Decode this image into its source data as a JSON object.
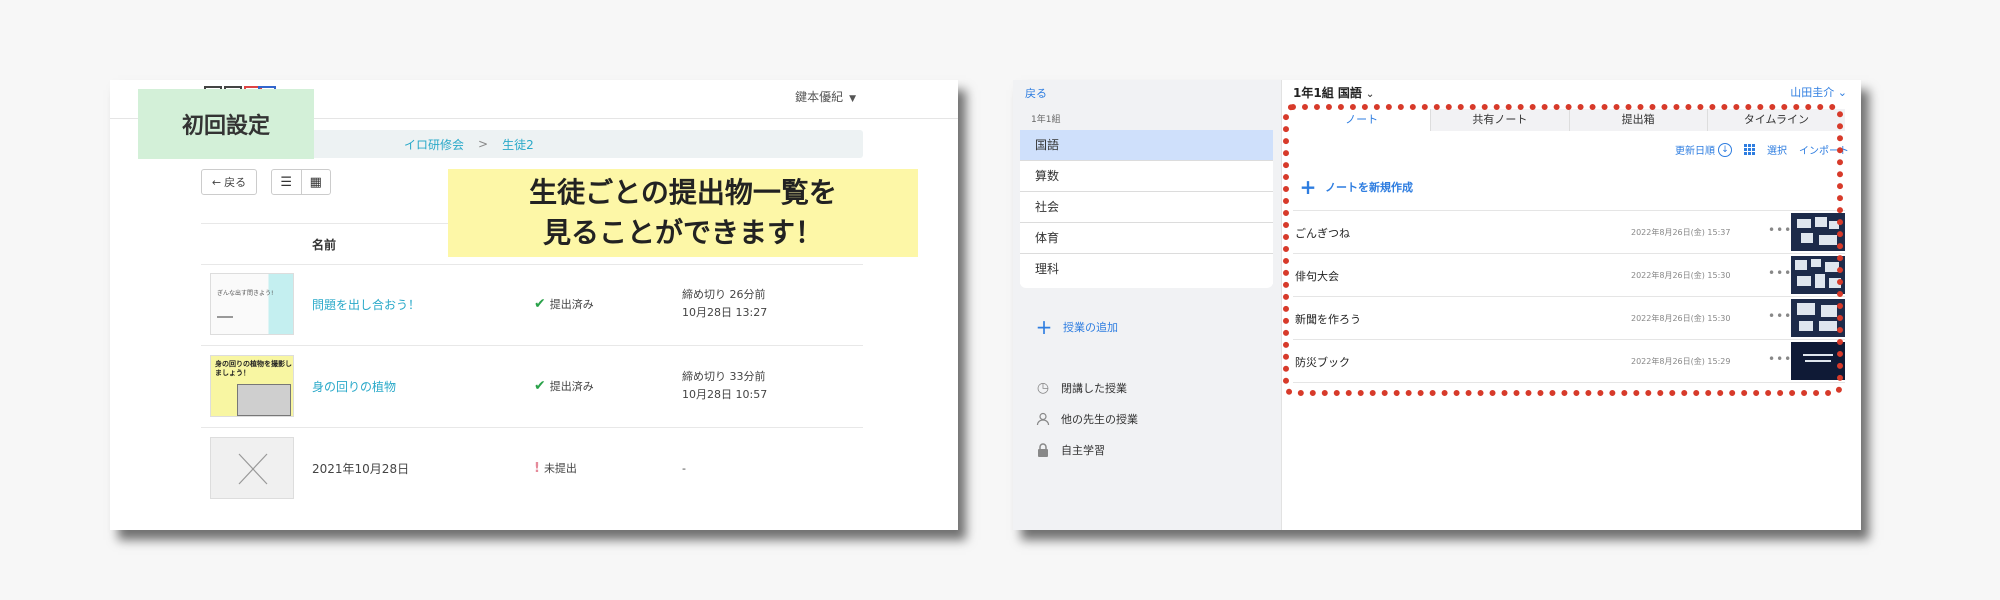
{
  "left_panel": {
    "user_name": "鍵本優紀",
    "first_setup_label": "初回設定",
    "breadcrumb": {
      "item1": "イロ研修会",
      "separator": ">",
      "item2": "生徒2"
    },
    "back_label": "戻る",
    "callout": {
      "line1": "生徒ごとの提出物一覧を",
      "line2": "見ることができます！"
    },
    "table_header": {
      "name": "名前"
    },
    "rows": [
      {
        "title": "問題を出し合おう！",
        "status": "提出済み",
        "deadline_line1": "締め切り 26分前",
        "deadline_line2": "10月28日 13:27",
        "thumb_text": "ぎんな出す問きよう!"
      },
      {
        "title": "身の回りの植物",
        "status": "提出済み",
        "deadline_line1": "締め切り 33分前",
        "deadline_line2": "10月28日 10:57",
        "thumb_text": "身の回りの植物を撮影しましょう！"
      },
      {
        "title": "2021年10月28日",
        "status": "未提出",
        "deadline_line1": "-"
      }
    ]
  },
  "right_panel": {
    "back": "戻る",
    "class_label": "1年1組",
    "subjects": [
      "国語",
      "算数",
      "社会",
      "体育",
      "理科"
    ],
    "selected_subject": "国語",
    "add_class": "授業の追加",
    "side_menu": [
      "閉講した授業",
      "他の先生の授業",
      "自主学習"
    ],
    "header_title": "1年1組 国語",
    "user": "山田圭介",
    "tabs": [
      "ノート",
      "共有ノート",
      "提出箱",
      "タイムライン"
    ],
    "toolbar": {
      "sort": "更新日順",
      "select": "選択",
      "import": "インポート"
    },
    "new_note": "ノートを新規作成",
    "notes": [
      {
        "title": "ごんぎつね",
        "date": "2022年8月26日(金) 15:37"
      },
      {
        "title": "俳句大会",
        "date": "2022年8月26日(金) 15:30"
      },
      {
        "title": "新聞を作ろう",
        "date": "2022年8月26日(金) 15:30"
      },
      {
        "title": "防災ブック",
        "date": "2022年8月26日(金) 15:29"
      }
    ]
  },
  "colors": {
    "link_blue": "#2aa9c9",
    "app_blue": "#2e7de0",
    "highlight_red": "#d73a2a",
    "callout_yellow": "#fdf7a7",
    "setup_green": "#d3f0d8"
  }
}
